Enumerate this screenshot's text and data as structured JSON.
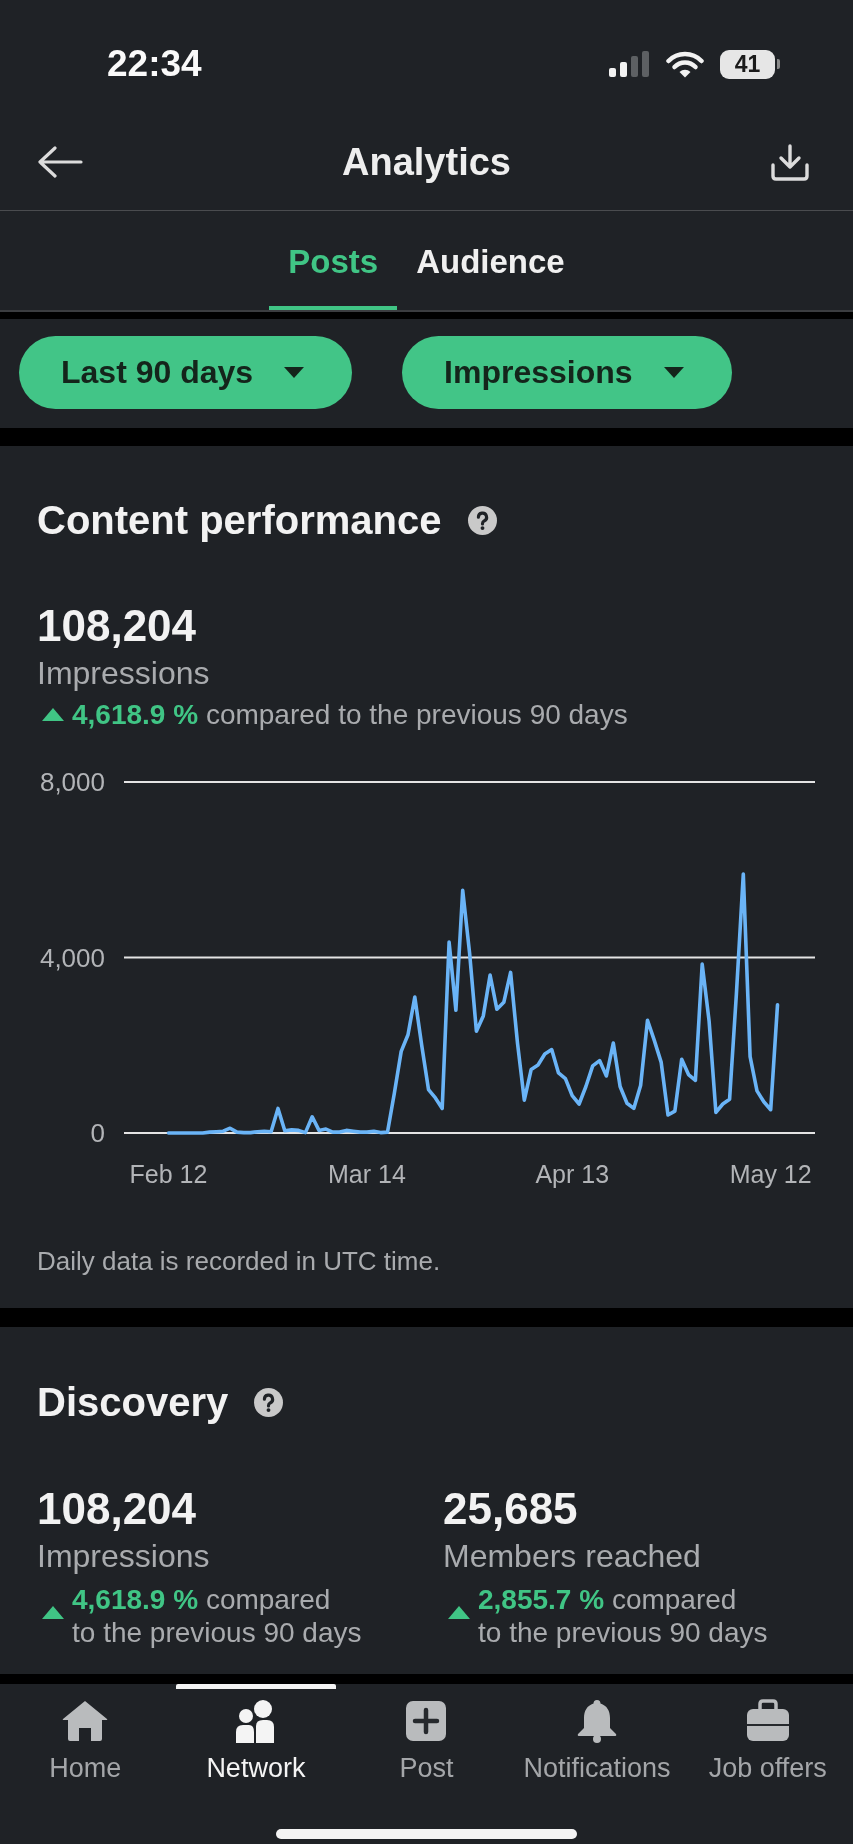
{
  "status_bar": {
    "time": "22:34",
    "battery": "41"
  },
  "header": {
    "title": "Analytics"
  },
  "tabs": [
    {
      "label": "Posts",
      "selected": true
    },
    {
      "label": "Audience",
      "selected": false
    }
  ],
  "filters": [
    {
      "label": "Last 90 days"
    },
    {
      "label": "Impressions"
    }
  ],
  "content_performance": {
    "title": "Content performance",
    "value": "108,204",
    "metric": "Impressions",
    "change": "**4,618.9 %** compared to the previous 90 days",
    "chart_data": {
      "type": "line",
      "categories": [
        "Feb 12",
        null,
        null,
        null,
        null,
        null,
        null,
        null,
        null,
        null,
        null,
        null,
        null,
        null,
        null,
        null,
        null,
        null,
        null,
        null,
        null,
        null,
        null,
        null,
        null,
        null,
        null,
        null,
        null,
        "Mar 14",
        null,
        null,
        null,
        null,
        null,
        null,
        null,
        null,
        null,
        null,
        null,
        null,
        null,
        null,
        null,
        null,
        null,
        null,
        null,
        null,
        null,
        null,
        null,
        null,
        null,
        null,
        null,
        null,
        null,
        "Apr 13",
        null,
        null,
        null,
        null,
        null,
        null,
        null,
        null,
        null,
        null,
        null,
        null,
        null,
        null,
        null,
        null,
        null,
        null,
        null,
        null,
        null,
        null,
        null,
        null,
        null,
        null,
        null,
        null,
        "May 12",
        null
      ],
      "series": [
        {
          "color": "#6ab4f7",
          "values": [
            0,
            0,
            0,
            0,
            0,
            0,
            20,
            30,
            40,
            110,
            20,
            10,
            10,
            30,
            40,
            30,
            560,
            50,
            70,
            60,
            10,
            370,
            60,
            90,
            20,
            20,
            60,
            40,
            20,
            20,
            40,
            10,
            20,
            900,
            1860,
            2240,
            3100,
            2000,
            990,
            800,
            560,
            4350,
            2800,
            5530,
            4100,
            2320,
            2670,
            3600,
            2820,
            2980,
            3660,
            2050,
            750,
            1450,
            1550,
            1800,
            1900,
            1370,
            1240,
            850,
            660,
            1060,
            1530,
            1650,
            1300,
            2050,
            1060,
            680,
            560,
            1080,
            2570,
            2110,
            1610,
            410,
            500,
            1680,
            1330,
            1200,
            3850,
            2550,
            470,
            660,
            770,
            3170,
            5900,
            1740,
            960,
            710,
            530,
            2920
          ]
        }
      ],
      "ylim": [
        0,
        8000
      ],
      "yticks": [
        0,
        {
          "value": 4000,
          "label": "4,000"
        },
        {
          "value": 8000,
          "label": "8,000"
        }
      ]
    },
    "footnote": "Daily data is recorded in UTC time."
  },
  "discovery": {
    "title": "Discovery",
    "stats": [
      {
        "value": "108,204",
        "metric": "Impressions",
        "change": "**4,618.9 %** compared\nto the previous 90 days"
      },
      {
        "value": "25,685",
        "metric": "Members reached",
        "change": "**2,855.7 %** compared\nto the previous 90 days"
      }
    ]
  },
  "bottom_nav": [
    {
      "label": "Home",
      "selected": false
    },
    {
      "label": "Network",
      "selected": true
    },
    {
      "label": "Post",
      "selected": false
    },
    {
      "label": "Notifications",
      "selected": false
    },
    {
      "label": "Job offers",
      "selected": false
    }
  ]
}
